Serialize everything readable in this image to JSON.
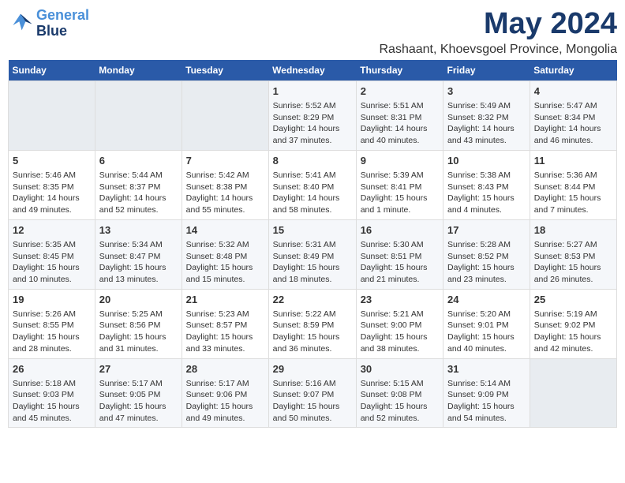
{
  "logo": {
    "line1": "General",
    "line2": "Blue"
  },
  "title": "May 2024",
  "subtitle": "Rashaant, Khoevsgoel Province, Mongolia",
  "days_header": [
    "Sunday",
    "Monday",
    "Tuesday",
    "Wednesday",
    "Thursday",
    "Friday",
    "Saturday"
  ],
  "weeks": [
    [
      {
        "day": "",
        "info": ""
      },
      {
        "day": "",
        "info": ""
      },
      {
        "day": "",
        "info": ""
      },
      {
        "day": "1",
        "info": "Sunrise: 5:52 AM\nSunset: 8:29 PM\nDaylight: 14 hours\nand 37 minutes."
      },
      {
        "day": "2",
        "info": "Sunrise: 5:51 AM\nSunset: 8:31 PM\nDaylight: 14 hours\nand 40 minutes."
      },
      {
        "day": "3",
        "info": "Sunrise: 5:49 AM\nSunset: 8:32 PM\nDaylight: 14 hours\nand 43 minutes."
      },
      {
        "day": "4",
        "info": "Sunrise: 5:47 AM\nSunset: 8:34 PM\nDaylight: 14 hours\nand 46 minutes."
      }
    ],
    [
      {
        "day": "5",
        "info": "Sunrise: 5:46 AM\nSunset: 8:35 PM\nDaylight: 14 hours\nand 49 minutes."
      },
      {
        "day": "6",
        "info": "Sunrise: 5:44 AM\nSunset: 8:37 PM\nDaylight: 14 hours\nand 52 minutes."
      },
      {
        "day": "7",
        "info": "Sunrise: 5:42 AM\nSunset: 8:38 PM\nDaylight: 14 hours\nand 55 minutes."
      },
      {
        "day": "8",
        "info": "Sunrise: 5:41 AM\nSunset: 8:40 PM\nDaylight: 14 hours\nand 58 minutes."
      },
      {
        "day": "9",
        "info": "Sunrise: 5:39 AM\nSunset: 8:41 PM\nDaylight: 15 hours\nand 1 minute."
      },
      {
        "day": "10",
        "info": "Sunrise: 5:38 AM\nSunset: 8:43 PM\nDaylight: 15 hours\nand 4 minutes."
      },
      {
        "day": "11",
        "info": "Sunrise: 5:36 AM\nSunset: 8:44 PM\nDaylight: 15 hours\nand 7 minutes."
      }
    ],
    [
      {
        "day": "12",
        "info": "Sunrise: 5:35 AM\nSunset: 8:45 PM\nDaylight: 15 hours\nand 10 minutes."
      },
      {
        "day": "13",
        "info": "Sunrise: 5:34 AM\nSunset: 8:47 PM\nDaylight: 15 hours\nand 13 minutes."
      },
      {
        "day": "14",
        "info": "Sunrise: 5:32 AM\nSunset: 8:48 PM\nDaylight: 15 hours\nand 15 minutes."
      },
      {
        "day": "15",
        "info": "Sunrise: 5:31 AM\nSunset: 8:49 PM\nDaylight: 15 hours\nand 18 minutes."
      },
      {
        "day": "16",
        "info": "Sunrise: 5:30 AM\nSunset: 8:51 PM\nDaylight: 15 hours\nand 21 minutes."
      },
      {
        "day": "17",
        "info": "Sunrise: 5:28 AM\nSunset: 8:52 PM\nDaylight: 15 hours\nand 23 minutes."
      },
      {
        "day": "18",
        "info": "Sunrise: 5:27 AM\nSunset: 8:53 PM\nDaylight: 15 hours\nand 26 minutes."
      }
    ],
    [
      {
        "day": "19",
        "info": "Sunrise: 5:26 AM\nSunset: 8:55 PM\nDaylight: 15 hours\nand 28 minutes."
      },
      {
        "day": "20",
        "info": "Sunrise: 5:25 AM\nSunset: 8:56 PM\nDaylight: 15 hours\nand 31 minutes."
      },
      {
        "day": "21",
        "info": "Sunrise: 5:23 AM\nSunset: 8:57 PM\nDaylight: 15 hours\nand 33 minutes."
      },
      {
        "day": "22",
        "info": "Sunrise: 5:22 AM\nSunset: 8:59 PM\nDaylight: 15 hours\nand 36 minutes."
      },
      {
        "day": "23",
        "info": "Sunrise: 5:21 AM\nSunset: 9:00 PM\nDaylight: 15 hours\nand 38 minutes."
      },
      {
        "day": "24",
        "info": "Sunrise: 5:20 AM\nSunset: 9:01 PM\nDaylight: 15 hours\nand 40 minutes."
      },
      {
        "day": "25",
        "info": "Sunrise: 5:19 AM\nSunset: 9:02 PM\nDaylight: 15 hours\nand 42 minutes."
      }
    ],
    [
      {
        "day": "26",
        "info": "Sunrise: 5:18 AM\nSunset: 9:03 PM\nDaylight: 15 hours\nand 45 minutes."
      },
      {
        "day": "27",
        "info": "Sunrise: 5:17 AM\nSunset: 9:05 PM\nDaylight: 15 hours\nand 47 minutes."
      },
      {
        "day": "28",
        "info": "Sunrise: 5:17 AM\nSunset: 9:06 PM\nDaylight: 15 hours\nand 49 minutes."
      },
      {
        "day": "29",
        "info": "Sunrise: 5:16 AM\nSunset: 9:07 PM\nDaylight: 15 hours\nand 50 minutes."
      },
      {
        "day": "30",
        "info": "Sunrise: 5:15 AM\nSunset: 9:08 PM\nDaylight: 15 hours\nand 52 minutes."
      },
      {
        "day": "31",
        "info": "Sunrise: 5:14 AM\nSunset: 9:09 PM\nDaylight: 15 hours\nand 54 minutes."
      },
      {
        "day": "",
        "info": ""
      }
    ]
  ]
}
